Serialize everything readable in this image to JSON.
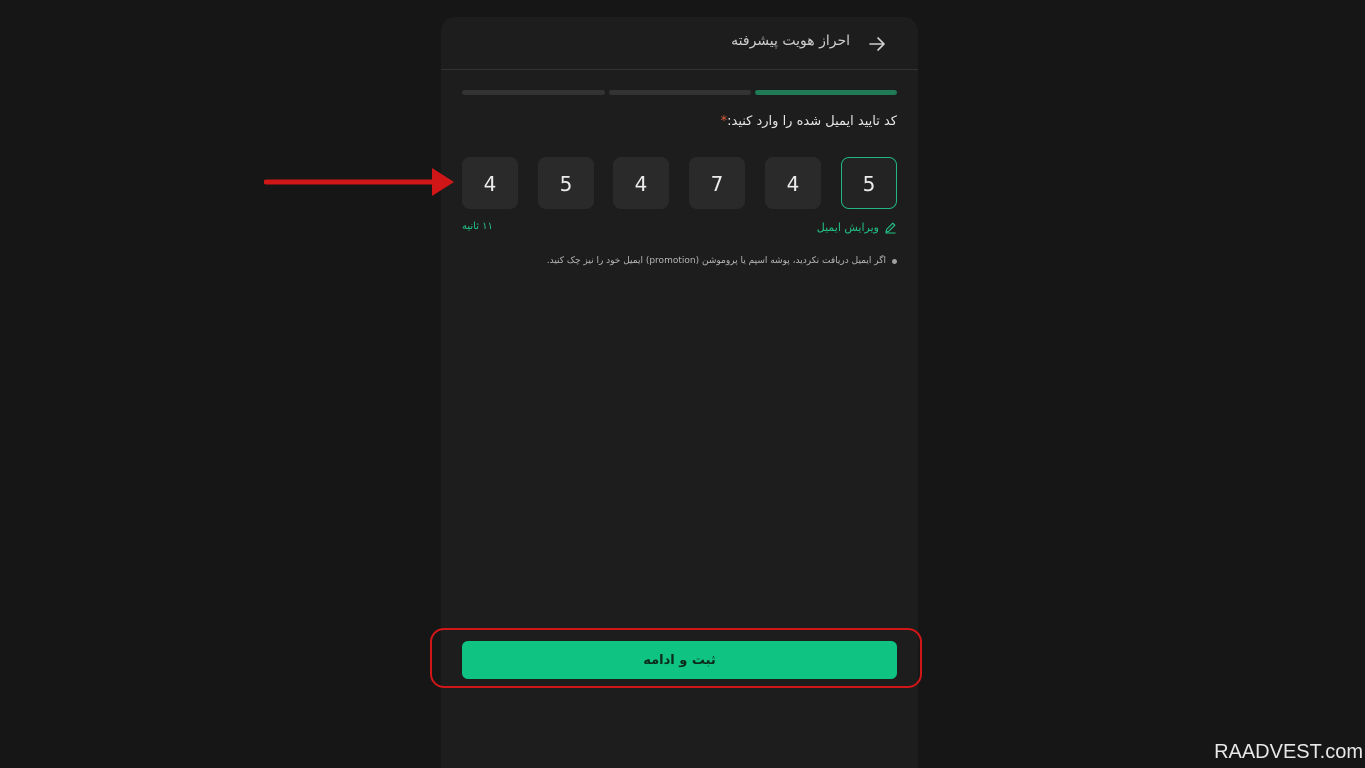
{
  "header": {
    "title": "احراز هویت پیشرفته",
    "back_icon": "arrow-right-icon"
  },
  "steps": {
    "total": 3,
    "completed": 1,
    "active_color": "#1f7a55",
    "inactive_color": "#333333"
  },
  "verification": {
    "label": "کد تایید ایمیل شده را وارد کنید:",
    "required_mark": "*",
    "digits": [
      "5",
      "4",
      "7",
      "4",
      "5",
      "4"
    ],
    "edit_email_label": "ویرایش ایمیل",
    "edit_icon": "pencil-icon",
    "timer": "۱۱ ثانیه",
    "hint": "اگر ایمیل دریافت نکردید، پوشه اسپم یا پروموشن (promotion) ایمیل خود را نیز چک کنید."
  },
  "submit": {
    "label": "ثبت و ادامه"
  },
  "annotation": {
    "arrow_color": "#d01616",
    "highlight_color": "#d01616"
  },
  "watermark": "RAADVEST.com",
  "colors": {
    "accent": "#0fc383",
    "background": "#161616",
    "card": "#1d1d1d"
  }
}
